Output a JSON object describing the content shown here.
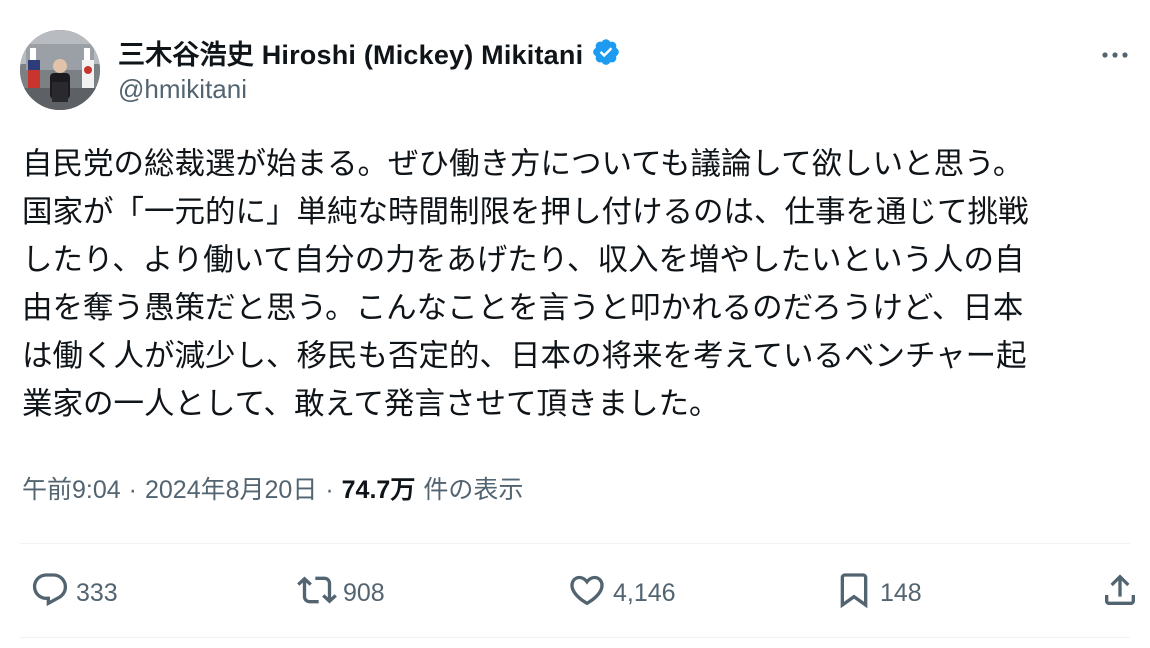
{
  "author": {
    "display_name": "三木谷浩史 Hiroshi (Mickey) Mikitani",
    "handle": "@hmikitani",
    "verified": true,
    "verified_color": "#1d9bf0",
    "avatar_icon": "profile-photo"
  },
  "tweet": {
    "text": "自民党の総裁選が始まる。ぜひ働き方についても議論して欲しいと思う。\n国家が「一元的に」単純な時間制限を押し付けるのは、仕事を通じて挑戦\nしたり、より働いて自分の力をあげたり、収入を増やしたいという人の自\n由を奪う愚策だと思う。こんなことを言うと叩かれるのだろうけど、日本\nは働く人が減少し、移民も否定的、日本の将来を考えているベンチャー起\n業家の一人として、敢えて発言させて頂きました。"
  },
  "meta": {
    "time": "午前9:04",
    "separator": "·",
    "date": "2024年8月20日",
    "views_count": "74.7万",
    "views_label": "件の表示"
  },
  "actions": {
    "reply_count": "333",
    "retweet_count": "908",
    "like_count": "4,146",
    "bookmark_count": "148"
  },
  "icons": {
    "more": "more-horizontal-icon",
    "reply": "reply-bubble-icon",
    "retweet": "retweet-icon",
    "like": "heart-icon",
    "bookmark": "bookmark-icon",
    "share": "share-upload-icon"
  },
  "colors": {
    "text_primary": "#0f1419",
    "text_secondary": "#536471",
    "divider": "#eff3f4",
    "accent": "#1d9bf0"
  }
}
